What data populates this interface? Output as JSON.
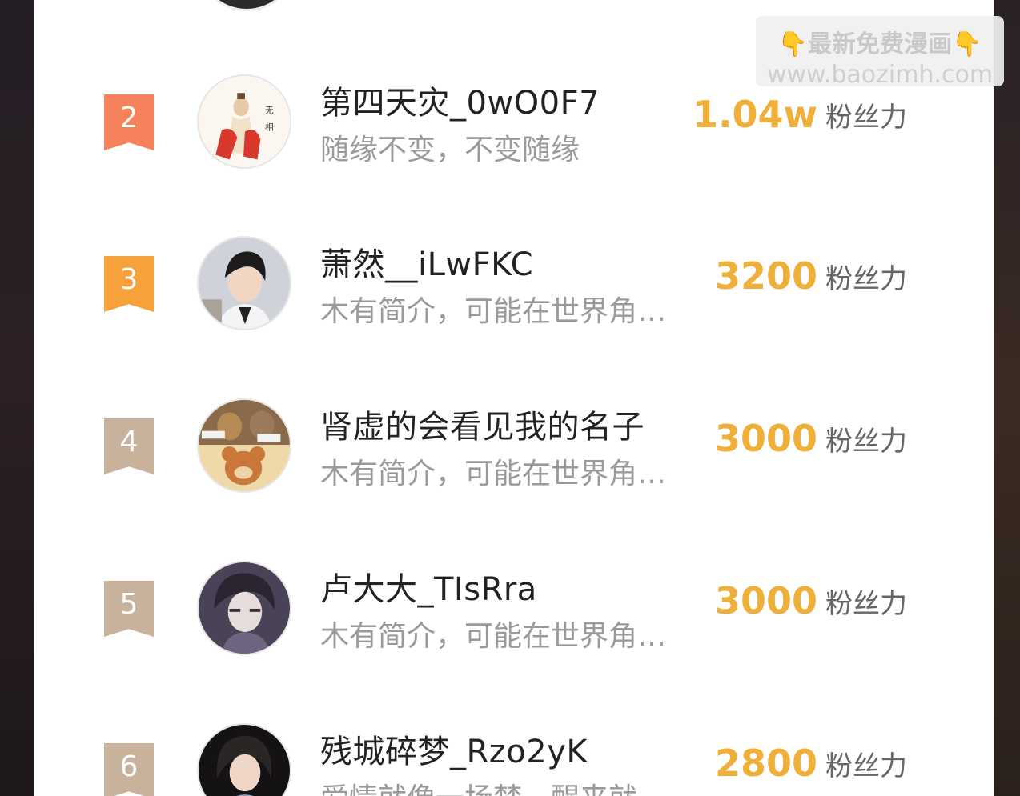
{
  "watermark": {
    "line1": "最新免费漫画",
    "line2": "www.baozimh.com",
    "hand_icon": "👇"
  },
  "fans_unit": "粉丝力",
  "colors": {
    "rank2": "#f5825a",
    "rank3": "#f7a13a",
    "rank_plain": "#c9b29c",
    "fans_value": "#eeb03a"
  },
  "rows": [
    {
      "rank": "2",
      "name": "第四天灾_0wO0F7",
      "bio": "随缘不变，不变随缘",
      "fans": "1.04w"
    },
    {
      "rank": "3",
      "name": "萧然__iLwFKC",
      "bio": "木有简介，可能在世界角落里发呆",
      "fans": "3200"
    },
    {
      "rank": "4",
      "name": "肾虚的会看见我的名子",
      "bio": "木有简介，可能在世界角落里发呆",
      "fans": "3000"
    },
    {
      "rank": "5",
      "name": "卢大大_TIsRra",
      "bio": "木有简介，可能在世界角落里发呆",
      "fans": "3000"
    },
    {
      "rank": "6",
      "name": "残城碎梦_Rzo2yK",
      "bio": "爱情就像一场梦，醒来就",
      "fans": "2800"
    }
  ]
}
